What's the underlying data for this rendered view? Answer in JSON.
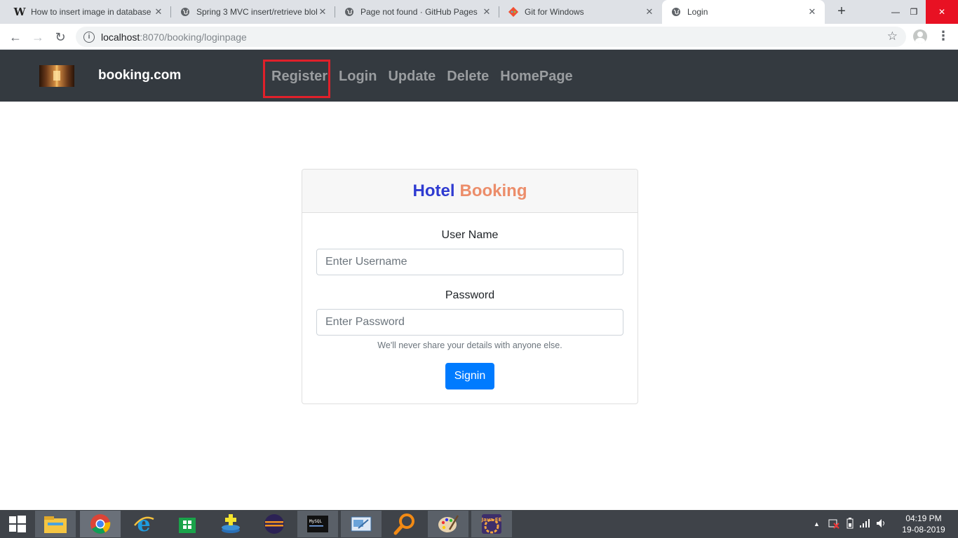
{
  "browser": {
    "tabs": [
      {
        "title": "How to insert image in database",
        "icon": "wordpress-w-icon"
      },
      {
        "title": "Spring 3 MVC insert/retrieve blob",
        "icon": "globe-icon"
      },
      {
        "title": "Page not found · GitHub Pages",
        "icon": "globe-icon"
      },
      {
        "title": "Git for Windows",
        "icon": "git-diamond-icon"
      },
      {
        "title": "Login",
        "icon": "globe-icon",
        "active": true
      }
    ],
    "new_tab": "+",
    "window_controls": {
      "minimize": "—",
      "restore": "❐",
      "close": "✕"
    },
    "url_host": "localhost",
    "url_rest": ":8070/booking/loginpage"
  },
  "navbar": {
    "brand": "booking.com",
    "links": [
      "Register",
      "Login",
      "Update",
      "Delete",
      "HomePage"
    ]
  },
  "card": {
    "title_part1": "Hotel",
    "title_part2": "Booking",
    "username_label": "User Name",
    "username_placeholder": "Enter Username",
    "password_label": "Password",
    "password_placeholder": "Enter Password",
    "help_text": "We'll never share your details with anyone else.",
    "submit_label": "Signin"
  },
  "taskbar": {
    "apps": [
      "file-explorer",
      "chrome",
      "internet-explorer",
      "store",
      "app-installer",
      "eclipse",
      "mysql",
      "remote-desktop",
      "search-tool",
      "paint",
      "java-ee-ide"
    ],
    "time": "04:19 PM",
    "date": "19-08-2019"
  },
  "colors": {
    "navbar_bg": "#343a40",
    "title_hotel": "#2f3bd1",
    "title_booking": "#ec8d6a",
    "button_bg": "#007bff",
    "highlight_border": "#e0202a"
  }
}
